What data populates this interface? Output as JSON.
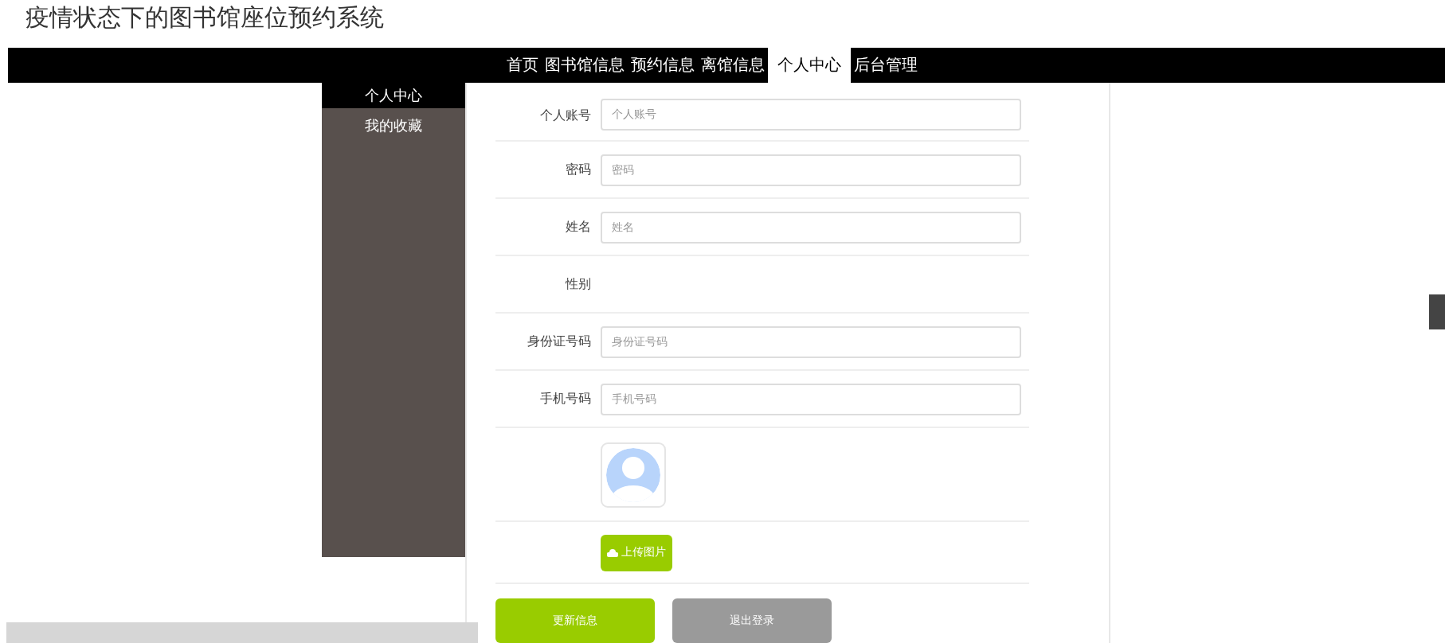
{
  "header": {
    "title": "疫情状态下的图书馆座位预约系统"
  },
  "nav": [
    {
      "label": "首页",
      "selected": false
    },
    {
      "label": "图书馆信息",
      "selected": false
    },
    {
      "label": "预约信息",
      "selected": false
    },
    {
      "label": "离馆信息",
      "selected": false
    },
    {
      "label": "个人中心",
      "selected": true
    },
    {
      "label": "后台管理",
      "selected": false
    }
  ],
  "sidebar": {
    "items": [
      {
        "label": "个人中心",
        "selected": true
      },
      {
        "label": "我的收藏",
        "selected": false
      }
    ]
  },
  "form": {
    "fields": [
      {
        "kind": "input",
        "label": "个人账号",
        "placeholder": "个人账号"
      },
      {
        "kind": "input",
        "label": "密码",
        "placeholder": "密码"
      },
      {
        "kind": "input",
        "label": "姓名",
        "placeholder": "姓名"
      },
      {
        "kind": "plain",
        "label": "性别"
      },
      {
        "kind": "input",
        "label": "身份证号码",
        "placeholder": "身份证号码"
      },
      {
        "kind": "input",
        "label": "手机号码",
        "placeholder": "手机号码"
      }
    ],
    "upload_button": "上传图片",
    "buttons": [
      {
        "label": "更新信息",
        "kind": "primary"
      },
      {
        "label": "退出登录",
        "kind": "secondary"
      }
    ]
  }
}
